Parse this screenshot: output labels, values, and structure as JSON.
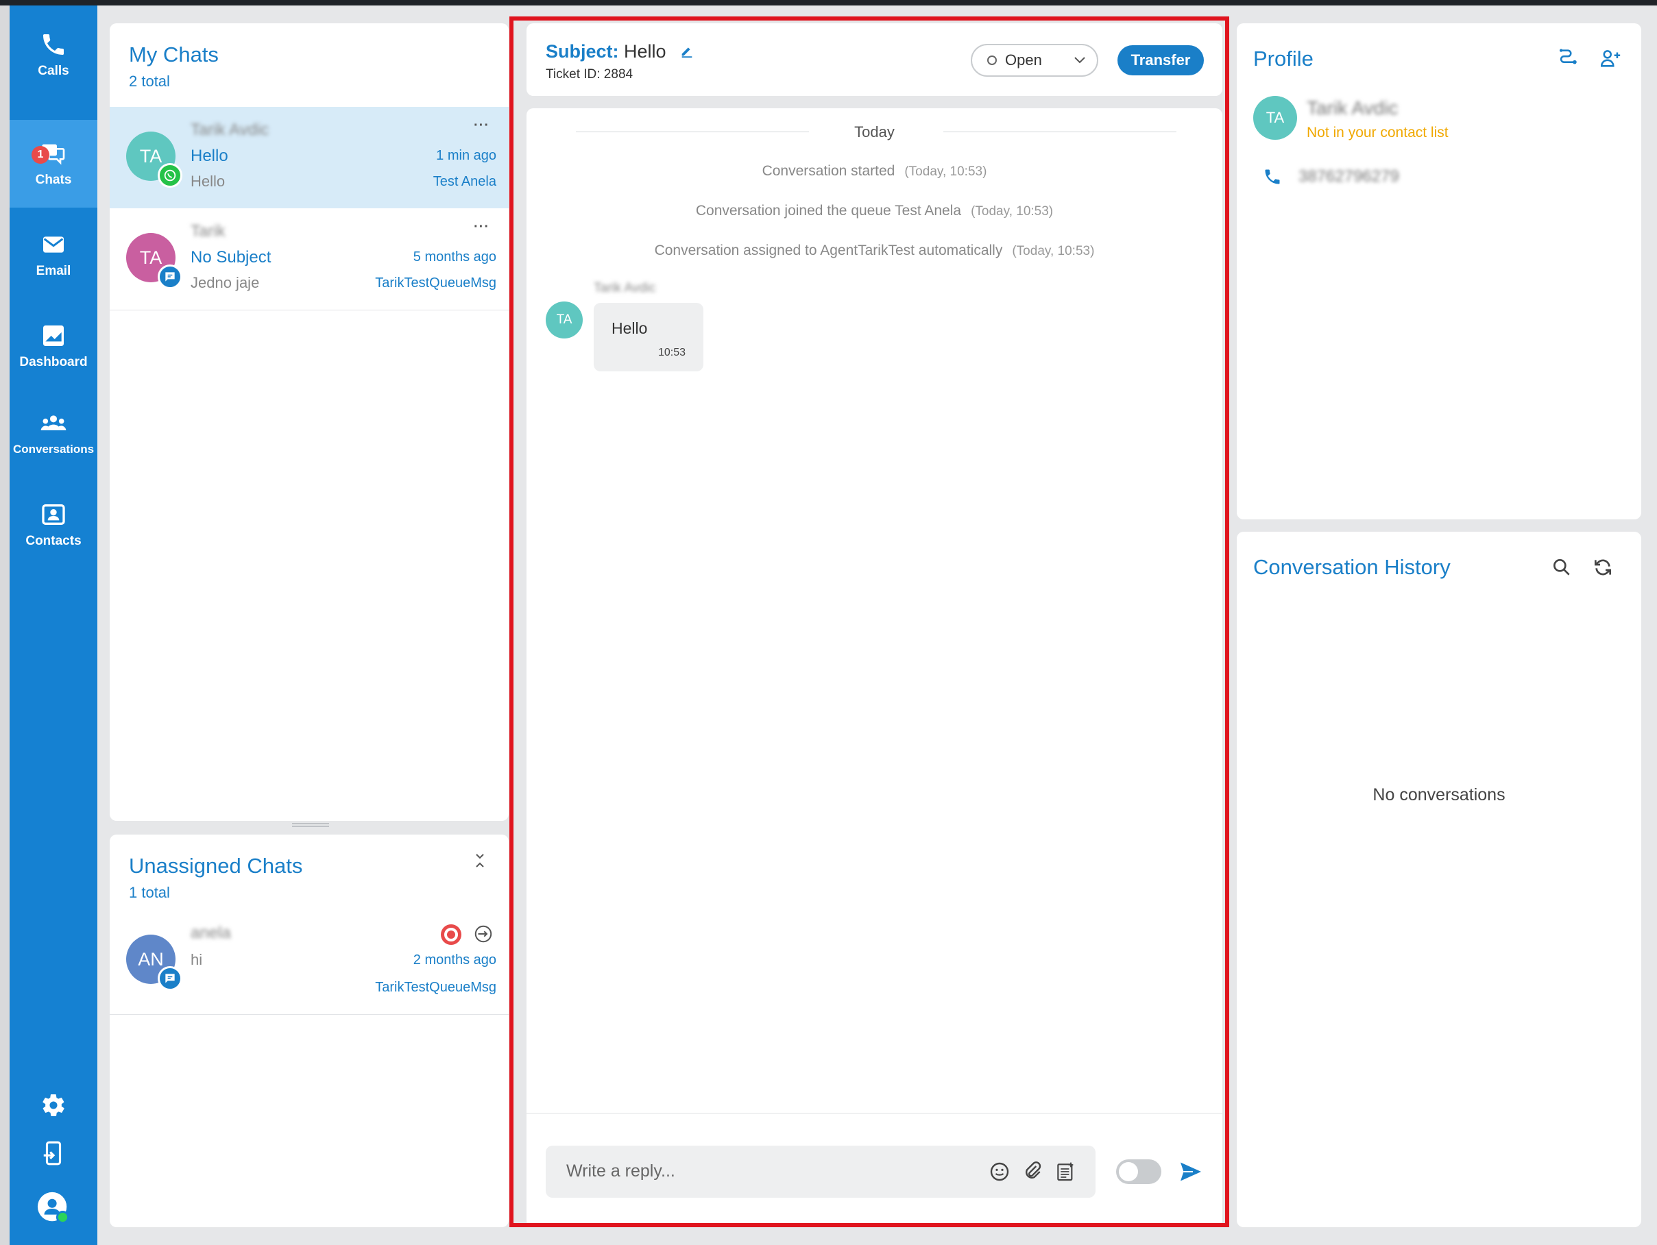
{
  "nav": {
    "items": [
      {
        "label": "Calls",
        "icon": "phone-icon"
      },
      {
        "label": "Chats",
        "icon": "chat-icon",
        "badge": "1"
      },
      {
        "label": "Email",
        "icon": "email-icon"
      },
      {
        "label": "Dashboard",
        "icon": "dashboard-icon"
      },
      {
        "label": "Conversations",
        "icon": "group-icon"
      },
      {
        "label": "Contacts",
        "icon": "contact-card-icon"
      }
    ],
    "bottom_icons": [
      "gear-icon",
      "logout-icon",
      "user-status-icon"
    ]
  },
  "my_chats": {
    "title": "My Chats",
    "total": "2 total",
    "items": [
      {
        "initials": "TA",
        "name": "Tarik Avdic",
        "subject": "Hello",
        "preview": "Hello",
        "time": "1 min ago",
        "queue": "Test Anela",
        "channel": "whatsapp-icon",
        "avatar_color": "#5fc7c0"
      },
      {
        "initials": "TA",
        "name": "Tarik",
        "subject": "No Subject",
        "preview": "Jedno jaje",
        "time": "5 months ago",
        "queue": "TarikTestQueueMsg",
        "channel": "chat-bubble-icon",
        "avatar_color": "#c95fa0"
      }
    ]
  },
  "unassigned": {
    "title": "Unassigned Chats",
    "total": "1 total",
    "items": [
      {
        "initials": "AN",
        "name": "anela",
        "preview": "hi",
        "time": "2 months ago",
        "queue": "TarikTestQueueMsg",
        "avatar_color": "#5f87c9"
      }
    ]
  },
  "conversation": {
    "subject_label": "Subject:",
    "subject": "Hello",
    "ticket": "Ticket ID: 2884",
    "status": "Open",
    "transfer_label": "Transfer",
    "day_label": "Today",
    "events": [
      {
        "text": "Conversation started",
        "time": "(Today, 10:53)"
      },
      {
        "text": "Conversation joined the queue Test Anela",
        "time": "(Today, 10:53)"
      },
      {
        "text": "Conversation assigned to AgentTarikTest automatically",
        "time": "(Today, 10:53)"
      }
    ],
    "message": {
      "sender": "Tarik Avdic",
      "initials": "TA",
      "text": "Hello",
      "time": "10:53"
    },
    "reply_placeholder": "Write a reply..."
  },
  "profile": {
    "title": "Profile",
    "initials": "TA",
    "name": "Tarik Avdic",
    "contact_status": "Not in your contact list",
    "phone": "38762796279"
  },
  "history": {
    "title": "Conversation History",
    "empty_text": "No conversations"
  },
  "colors": {
    "accent": "#1a7fc8",
    "nav": "#1581d2",
    "warning": "#f0a800",
    "frame": "#e0141e"
  }
}
